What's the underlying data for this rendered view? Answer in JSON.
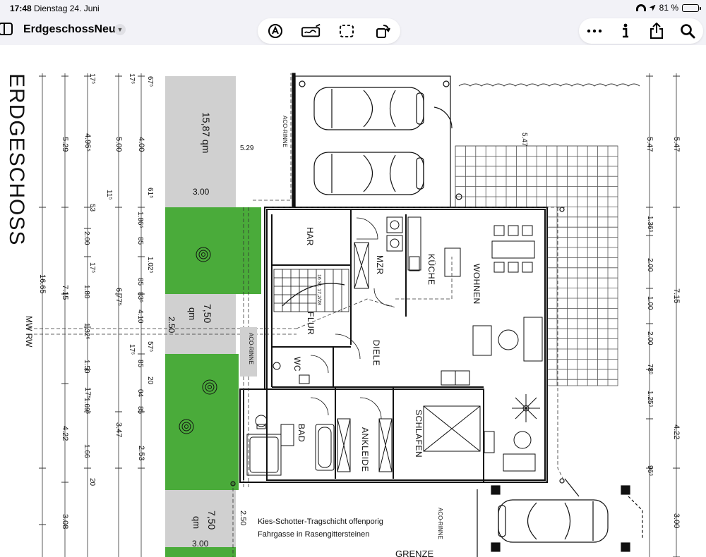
{
  "status_bar": {
    "time": "17:48",
    "date": "Dienstag 24. Juni",
    "battery": "81 %",
    "battery_level": 0.81
  },
  "toolbar": {
    "document_title": "ErdgeschossNeu",
    "icons": [
      "sidebar-icon",
      "chevron-down-icon",
      "markup-icon",
      "signature-icon",
      "selection-icon",
      "rotate-icon",
      "more-icon",
      "info-icon",
      "share-icon",
      "search-icon"
    ]
  },
  "plan": {
    "floor_title": "ERDGESCHOSS",
    "rooms": {
      "har": "HAR",
      "mzr": "MZR",
      "kueche": "KÜCHE",
      "wohnen": "WOHNEN",
      "flur": "FLUR",
      "wc": "WC",
      "diele": "DIELE",
      "bad": "BAD",
      "ankleide": "ANKLEIDE",
      "schlafen": "SCHLAFEN"
    },
    "areas": {
      "top_area": "15,87 qm",
      "top_width": "3.00",
      "mid_area": "7,50",
      "mid_unit": "qm",
      "mid_width": "2.50",
      "bottom_area": "7,50",
      "bottom_unit": "qm",
      "bottom_width": "3.00",
      "bottom_side": "2.50"
    },
    "labels": {
      "aco_rinne_1": "ACO-RINNE",
      "aco_rinne_2": "ACO-RINNE",
      "aco_rinne_3": "ACO-RINNE",
      "mw_rw": "MW RW",
      "stair": "16 St. 17,2/28",
      "note_line1": "Kies-Schotter-Tragschicht offenporig",
      "note_line2": "Fahrgasse in Rasengittersteinen",
      "grenze": "GRENZE"
    },
    "dims_col1": [
      "5.29",
      "16.65",
      "4.22",
      "3.08"
    ],
    "dims_col2": [
      "4.96⁵",
      "7.15",
      "17⁵"
    ],
    "dims_col3": [
      "5.00",
      "6.77⁵",
      "3.47"
    ],
    "dims_col4": [
      "4.00",
      "2.53"
    ],
    "dims_right_outer": [
      "5.47",
      "7.15",
      "4.22",
      "3.00"
    ],
    "dims_right_inner": [
      "5.47",
      "1.36⁵",
      "2.00",
      "1.00",
      "2.00",
      "1.25⁵",
      "96⁵"
    ],
    "dims_top": "5.47",
    "dims_small": [
      "17⁵",
      "17⁵",
      "67⁵",
      "53",
      "2.00",
      "17⁵",
      "1.80",
      "1.32⁵",
      "1.50",
      "1.69⁵",
      "1.66",
      "20",
      "11⁵",
      "17⁵",
      "61⁵",
      "1.02⁵",
      "85",
      "83⁵",
      "4.10",
      "57⁵",
      "85",
      "04",
      "85",
      "20",
      "78⁵",
      "1.86⁵",
      "85"
    ]
  }
}
